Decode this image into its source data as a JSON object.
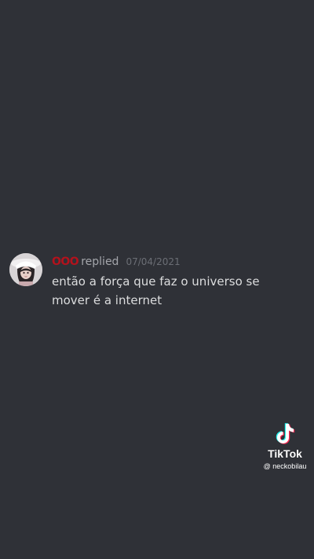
{
  "message": {
    "username": "OOO",
    "action": "replied",
    "timestamp": "07/04/2021",
    "text": "então a força que faz o universo se mover é a internet",
    "colors": {
      "username": "#b3121c",
      "text": "#dcddde",
      "background": "#2f3137"
    }
  },
  "watermark": {
    "brand": "TikTok",
    "handle": "@ neckobilau",
    "icon": "tiktok-logo-icon"
  }
}
